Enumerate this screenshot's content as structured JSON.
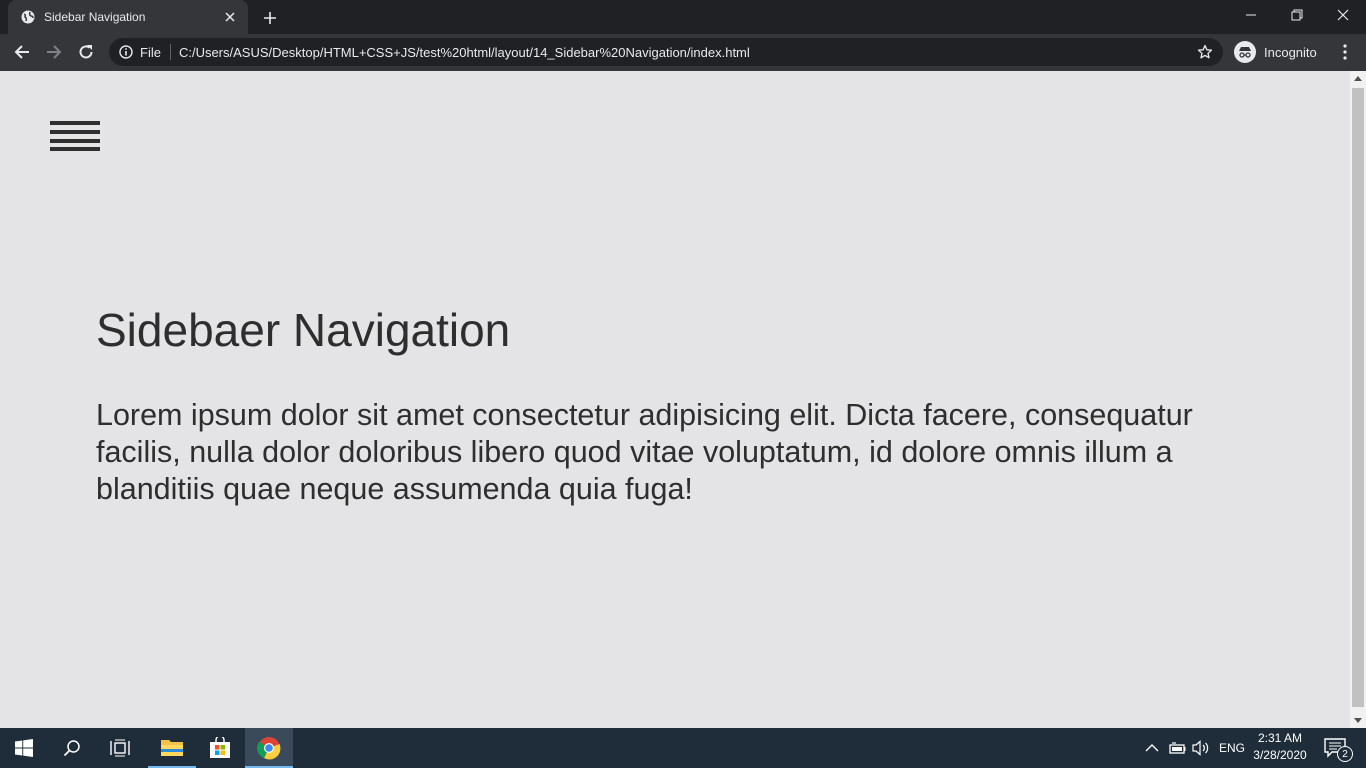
{
  "browser": {
    "tab": {
      "title": "Sidebar Navigation",
      "favicon": "globe-icon"
    },
    "new_tab_icon": "plus-icon",
    "window_controls": [
      "minimize-icon",
      "restore-icon",
      "close-icon"
    ],
    "address_bar": {
      "scheme_label": "File",
      "url": "C:/Users/ASUS/Desktop/HTML+CSS+JS/test%20html/layout/14_Sidebar%20Navigation/index.html"
    },
    "profile_label": "Incognito"
  },
  "page": {
    "menu_icon": "hamburger-icon",
    "title": "Sidebaer Navigation",
    "text": "Lorem ipsum dolor sit amet consectetur adipisicing elit. Dicta facere, consequatur facilis, nulla dolor doloribus libero quod vitae voluptatum, id dolore omnis illum a blanditiis quae neque assumenda quia fuga!",
    "background_color": "#e4e4e6",
    "text_color": "#2e2e2e"
  },
  "taskbar": {
    "apps": [
      "start-icon",
      "search-icon",
      "task-view-icon",
      "file-explorer-icon",
      "store-icon",
      "chrome-icon"
    ],
    "language": "ENG",
    "time": "2:31 AM",
    "date": "3/28/2020",
    "notification_count": "2"
  }
}
